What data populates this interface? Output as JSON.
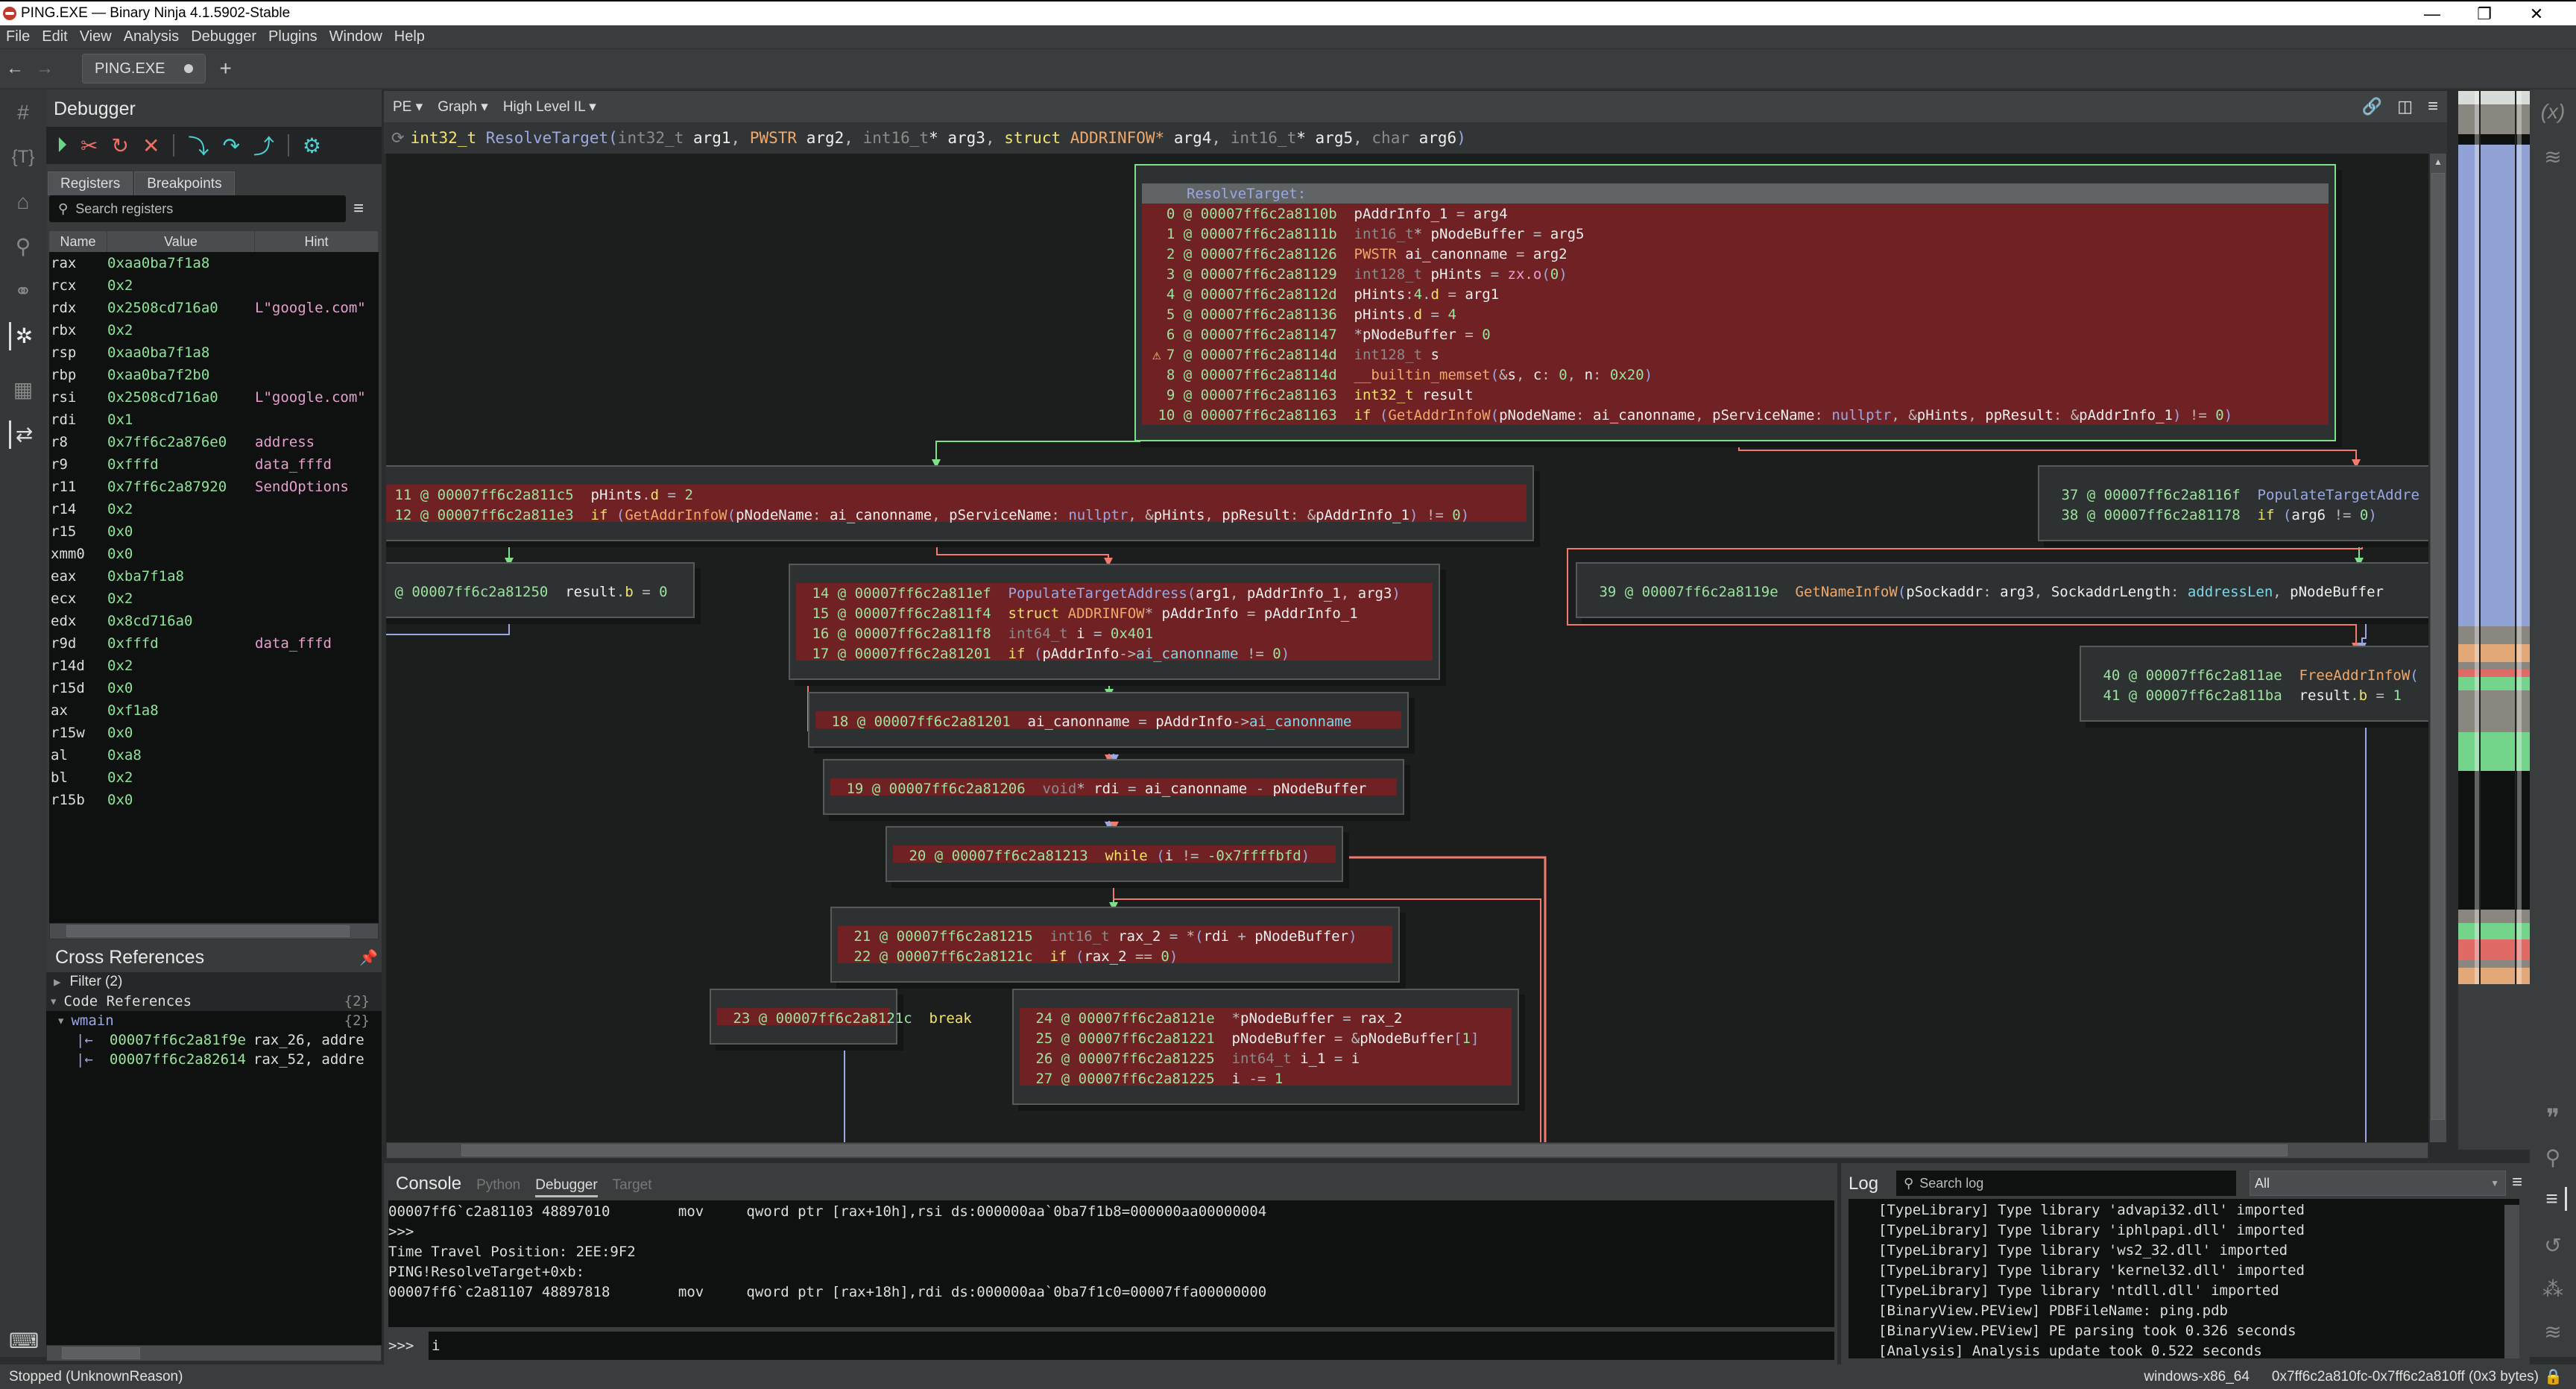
{
  "window": {
    "title": "PING.EXE — Binary Ninja 4.1.5902-Stable",
    "controls": [
      "minimize",
      "restore",
      "close"
    ]
  },
  "menu": [
    "File",
    "Edit",
    "View",
    "Analysis",
    "Debugger",
    "Plugins",
    "Window",
    "Help"
  ],
  "tabs": {
    "back": "←",
    "forward": "→",
    "open_tab": "PING.EXE",
    "add": "+"
  },
  "left_sidebar_icons": [
    "hash-icon",
    "type-icon",
    "tag-icon",
    "location-icon",
    "graph-icon",
    "bug-icon",
    "hierarchy-icon",
    "transfer-icon"
  ],
  "debugger": {
    "title": "Debugger",
    "toolbar": [
      "resume",
      "detach",
      "restart",
      "stop",
      "step-into",
      "step-over",
      "step-out",
      "settings"
    ],
    "tabs": [
      "Registers",
      "Breakpoints"
    ],
    "search_placeholder": "Search registers",
    "columns": [
      "Name",
      "Value",
      "Hint"
    ],
    "registers": [
      {
        "name": "rax",
        "value": "0xaa0ba7f1a8",
        "hint": ""
      },
      {
        "name": "rcx",
        "value": "0x2",
        "hint": ""
      },
      {
        "name": "rdx",
        "value": "0x2508cd716a0",
        "hint": "L\"google.com\""
      },
      {
        "name": "rbx",
        "value": "0x2",
        "hint": ""
      },
      {
        "name": "rsp",
        "value": "0xaa0ba7f1a8",
        "hint": ""
      },
      {
        "name": "rbp",
        "value": "0xaa0ba7f2b0",
        "hint": ""
      },
      {
        "name": "rsi",
        "value": "0x2508cd716a0",
        "hint": "L\"google.com\""
      },
      {
        "name": "rdi",
        "value": "0x1",
        "hint": ""
      },
      {
        "name": "r8",
        "value": "0x7ff6c2a876e0",
        "hint": "address"
      },
      {
        "name": "r9",
        "value": "0xfffd",
        "hint": "data_fffd"
      },
      {
        "name": "r11",
        "value": "0x7ff6c2a87920",
        "hint": "SendOptions"
      },
      {
        "name": "r14",
        "value": "0x2",
        "hint": ""
      },
      {
        "name": "r15",
        "value": "0x0",
        "hint": ""
      },
      {
        "name": "xmm0",
        "value": "0x0",
        "hint": ""
      },
      {
        "name": "eax",
        "value": "0xba7f1a8",
        "hint": ""
      },
      {
        "name": "ecx",
        "value": "0x2",
        "hint": ""
      },
      {
        "name": "edx",
        "value": "0x8cd716a0",
        "hint": ""
      },
      {
        "name": "r9d",
        "value": "0xfffd",
        "hint": "data_fffd"
      },
      {
        "name": "r14d",
        "value": "0x2",
        "hint": ""
      },
      {
        "name": "r15d",
        "value": "0x0",
        "hint": ""
      },
      {
        "name": "ax",
        "value": "0xf1a8",
        "hint": ""
      },
      {
        "name": "r15w",
        "value": "0x0",
        "hint": ""
      },
      {
        "name": "al",
        "value": "0xa8",
        "hint": ""
      },
      {
        "name": "bl",
        "value": "0x2",
        "hint": ""
      },
      {
        "name": "r15b",
        "value": "0x0",
        "hint": ""
      }
    ]
  },
  "xrefs": {
    "title": "Cross References",
    "filter": "Filter (2)",
    "code_refs": "Code References",
    "code_refs_count": "{2}",
    "func": "wmain",
    "func_count": "{2}",
    "items": [
      {
        "addr": "00007ff6c2a81f9e",
        "text": "rax_26, addre"
      },
      {
        "addr": "00007ff6c2a82614",
        "text": "rax_52, addre"
      }
    ]
  },
  "graph_header": {
    "view_type": "PE",
    "view_mode": "Graph",
    "il_level": "High Level IL",
    "signature": {
      "ret": "int32_t",
      "name": "ResolveTarget",
      "params": [
        {
          "type": "int32_t",
          "name": "arg1"
        },
        {
          "type": "PWSTR",
          "name": "arg2"
        },
        {
          "type": "int16_t*",
          "name": "arg3"
        },
        {
          "type": "struct ADDRINFOW*",
          "name": "arg4"
        },
        {
          "type": "int16_t*",
          "name": "arg5"
        },
        {
          "type": "char",
          "name": "arg6"
        }
      ]
    }
  },
  "blocks": {
    "entry_label": "ResolveTarget:",
    "b0": [
      [
        "0",
        "00007ff6c2a8110b",
        "pAddrInfo_1 = arg4"
      ],
      [
        "1",
        "00007ff6c2a8111b",
        "int16_t* pNodeBuffer = arg5"
      ],
      [
        "2",
        "00007ff6c2a81126",
        "PWSTR ai_canonname = arg2"
      ],
      [
        "3",
        "00007ff6c2a81129",
        "int128_t pHints = zx.o(0)"
      ],
      [
        "4",
        "00007ff6c2a8112d",
        "pHints:4.d = arg1"
      ],
      [
        "5",
        "00007ff6c2a81136",
        "pHints.d = 4"
      ],
      [
        "6",
        "00007ff6c2a81147",
        "*pNodeBuffer = 0"
      ],
      [
        "7",
        "00007ff6c2a8114d",
        "int128_t s"
      ],
      [
        "8",
        "00007ff6c2a8114d",
        "__builtin_memset(&s, c: 0, n: 0x20)"
      ],
      [
        "9",
        "00007ff6c2a81163",
        "int32_t result"
      ],
      [
        "10",
        "00007ff6c2a81163",
        "if (GetAddrInfoW(pNodeName: ai_canonname, pServiceName: nullptr, &pHints, ppResult: &pAddrInfo_1) != 0)"
      ]
    ],
    "b1": [
      [
        "11",
        "00007ff6c2a811c5",
        "pHints.d = 2"
      ],
      [
        "12",
        "00007ff6c2a811e3",
        "if (GetAddrInfoW(pNodeName: ai_canonname, pServiceName: nullptr, &pHints, ppResult: &pAddrInfo_1) != 0)"
      ]
    ],
    "b2": [
      [
        "",
        "00007ff6c2a81250",
        "result.b = 0"
      ]
    ],
    "b3": [
      [
        "14",
        "00007ff6c2a811ef",
        "PopulateTargetAddress(arg1, pAddrInfo_1, arg3)"
      ],
      [
        "15",
        "00007ff6c2a811f4",
        "struct ADDRINFOW* pAddrInfo = pAddrInfo_1"
      ],
      [
        "16",
        "00007ff6c2a811f8",
        "int64_t i = 0x401"
      ],
      [
        "17",
        "00007ff6c2a81201",
        "if (pAddrInfo->ai_canonname != 0)"
      ]
    ],
    "b4": [
      [
        "18",
        "00007ff6c2a81201",
        "ai_canonname = pAddrInfo->ai_canonname"
      ]
    ],
    "b5": [
      [
        "19",
        "00007ff6c2a81206",
        "void* rdi = ai_canonname - pNodeBuffer"
      ]
    ],
    "b6": [
      [
        "20",
        "00007ff6c2a81213",
        "while (i != -0x7ffffbfd)"
      ]
    ],
    "b7": [
      [
        "21",
        "00007ff6c2a81215",
        "int16_t rax_2 = *(rdi + pNodeBuffer)"
      ],
      [
        "22",
        "00007ff6c2a8121c",
        "if (rax_2 == 0)"
      ]
    ],
    "b8": [
      [
        "23",
        "00007ff6c2a8121c",
        "break"
      ]
    ],
    "b9": [
      [
        "24",
        "00007ff6c2a8121e",
        "*pNodeBuffer = rax_2"
      ],
      [
        "25",
        "00007ff6c2a81221",
        "pNodeBuffer = &pNodeBuffer[1]"
      ],
      [
        "26",
        "00007ff6c2a81225",
        "int64_t i_1 = i"
      ],
      [
        "27",
        "00007ff6c2a81225",
        "i -= 1"
      ]
    ],
    "b10": [
      [
        "37",
        "00007ff6c2a8116f",
        "PopulateTargetAddre"
      ],
      [
        "38",
        "00007ff6c2a81178",
        "if (arg6 != 0)"
      ]
    ],
    "b11": [
      [
        "39",
        "00007ff6c2a8119e",
        "GetNameInfoW(pSockaddr: arg3, SockaddrLength: addressLen, pNodeBuffer"
      ]
    ],
    "b12": [
      [
        "40",
        "00007ff6c2a811ae",
        "FreeAddrInfoW("
      ],
      [
        "41",
        "00007ff6c2a811ba",
        "result.b = 1"
      ]
    ]
  },
  "console": {
    "tabs": [
      "Console",
      "Python",
      "Debugger",
      "Target"
    ],
    "active_tab": "Debugger",
    "lines": [
      "00007ff6`c2a81103 48897010        mov     qword ptr [rax+10h],rsi ds:000000aa`0ba7f1b8=000000aa00000004",
      ">>>",
      "Time Travel Position: 2EE:9F2",
      "PING!ResolveTarget+0xb:",
      "00007ff6`c2a81107 48897818        mov     qword ptr [rax+18h],rdi ds:000000aa`0ba7f1c0=00007ffa00000000"
    ],
    "prompt": ">>>",
    "input_value": "i"
  },
  "log": {
    "title": "Log",
    "search_placeholder": "Search log",
    "filter_value": "All",
    "lines": [
      "[TypeLibrary] Type library 'advapi32.dll' imported",
      "[TypeLibrary] Type library 'iphlpapi.dll' imported",
      "[TypeLibrary] Type library 'ws2_32.dll' imported",
      "[TypeLibrary] Type library 'kernel32.dll' imported",
      "[TypeLibrary] Type library 'ntdll.dll' imported",
      "[BinaryView.PEView] PDBFileName: ping.pdb",
      "[BinaryView.PEView] PE parsing took 0.326 seconds",
      "[Analysis] Analysis update took 0.522 seconds"
    ]
  },
  "status": {
    "state": "Stopped (UnknownReason)",
    "platform": "windows-x86_64",
    "selection": "0x7ff6c2a810fc-0x7ff6c2a810ff (0x3 bytes)"
  },
  "colors": {
    "highlight_block": "#702123",
    "true_edge": "#7fe08a",
    "false_edge": "#f07a6e",
    "unconditional_edge": "#9aa8e3",
    "address": "#9be39e",
    "keyword": "#f2e36a"
  }
}
